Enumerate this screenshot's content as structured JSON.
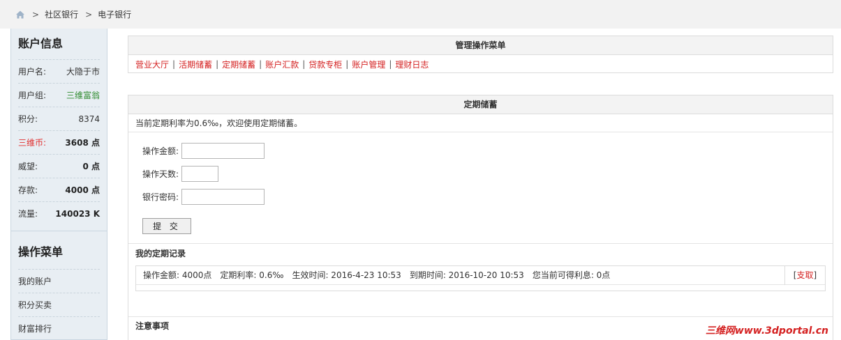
{
  "breadcrumb": {
    "home_icon": "home-icon",
    "items": [
      "社区银行",
      "电子银行"
    ],
    "separator": ">"
  },
  "sidebar": {
    "account_title": "账户信息",
    "rows": [
      {
        "key": "用户名:",
        "value": "大隐于市"
      },
      {
        "key": "用户组:",
        "value": "三维富翁"
      },
      {
        "key": "积分:",
        "value": "8374"
      },
      {
        "key": "三维币:",
        "value": "3608 点"
      },
      {
        "key": "威望:",
        "value": "0 点"
      },
      {
        "key": "存款:",
        "value": "4000 点"
      },
      {
        "key": "流量:",
        "value": "140023 K"
      }
    ],
    "menu_title": "操作菜单",
    "menu": [
      "我的账户",
      "积分买卖",
      "财富排行"
    ]
  },
  "ops_menu": {
    "title": "管理操作菜单",
    "links": [
      "营业大厅",
      "活期储蓄",
      "定期储蓄",
      "账户汇款",
      "贷款专柜",
      "账户管理",
      "理财日志"
    ]
  },
  "deposit": {
    "title": "定期储蓄",
    "info": "当前定期利率为0.6‰，欢迎使用定期储蓄。",
    "form": {
      "amount_label": "操作金额:",
      "amount_value": "",
      "days_label": "操作天数:",
      "days_value": "",
      "password_label": "银行密码:",
      "password_value": "",
      "submit_label": "提 交"
    },
    "records_title": "我的定期记录",
    "record": {
      "amount": "操作金额: 4000点",
      "rate": "定期利率: 0.6‰",
      "start": "生效时间: 2016-4-23 10:53",
      "end": "到期时间: 2016-10-20 10:53",
      "interest": "您当前可得利息: 0点",
      "action_open": "[",
      "action_label": "支取",
      "action_close": "]"
    },
    "notice_title": "注意事项"
  },
  "watermark": "三维网www.3dportal.cn",
  "colors": {
    "link_red": "#d42020",
    "group_green": "#2e8b2e",
    "sidebar_bg": "#e8eef3"
  }
}
